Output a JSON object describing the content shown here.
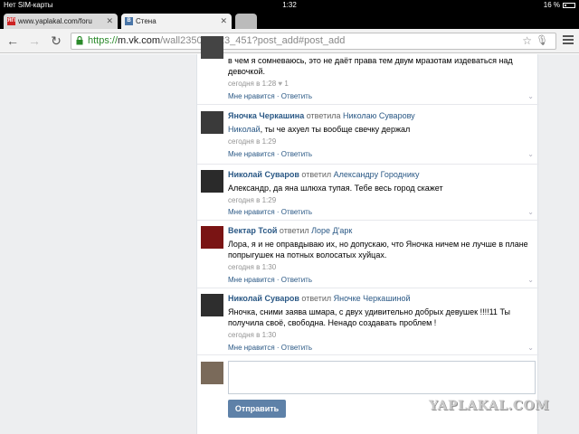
{
  "status_bar": {
    "carrier": "Нет SIM-карты",
    "time": "1:32",
    "battery": "16 %"
  },
  "tabs": [
    {
      "title": "www.yaplakal.com/foru",
      "favicon": "yaplakal-favicon",
      "favicon_text": "ЯП",
      "favicon_color": "#cc2222"
    },
    {
      "title": "Стена",
      "favicon": "vk-favicon",
      "favicon_text": "B",
      "favicon_color": "#4a76a8"
    }
  ],
  "toolbar": {
    "url_scheme": "https://",
    "url_host": "m.vk.com",
    "url_path": "/wall235020923_451?post_add#post_add"
  },
  "comments": [
    {
      "text": "в чем я сомневаюсь, это не даёт права тем двум мразотам издеваться над девочкой.",
      "date": "сегодня в 1:28",
      "likes": "1",
      "actions": "Мне нравится · Ответить"
    },
    {
      "author": "Яночка Черкашина",
      "verb": "ответила",
      "target": "Николаю Суварову",
      "mention": "Николай",
      "text": ", ты че ахуел ты вообще свечку держал",
      "date": "сегодня в 1:29",
      "actions": "Мне нравится · Ответить"
    },
    {
      "author": "Николай Суваров",
      "verb": "ответил",
      "target": "Александру Городнику",
      "text": "Александр, да яна шлюха тупая. Тебе весь город скажет",
      "date": "сегодня в 1:29",
      "actions": "Мне нравится · Ответить"
    },
    {
      "author": "Вектар Тсой",
      "verb": "ответил",
      "target": "Лоре Д'арк",
      "text": "Лора, я и не оправдываю их, но допускаю, что Яночка ничем не лучше в плане попрыгушек на потных волосатых хуйцах.",
      "date": "сегодня в 1:30",
      "actions": "Мне нравится · Ответить"
    },
    {
      "author": "Николай Суваров",
      "verb": "ответил",
      "target": "Яночке Черкашиной",
      "text": "Яночка, сними заява шмара, с двух удивительно добрых девушек !!!!11 Ты получила своё, свободна. Ненадо создавать проблем !",
      "date": "сегодня в 1:30",
      "actions": "Мне нравится · Ответить"
    }
  ],
  "reply": {
    "send_label": "Отправить"
  },
  "watermark": "YAPLAKAL.COM",
  "colors": {
    "link": "#2a5885",
    "button": "#5e81a8",
    "page_bg": "#edeef0"
  }
}
